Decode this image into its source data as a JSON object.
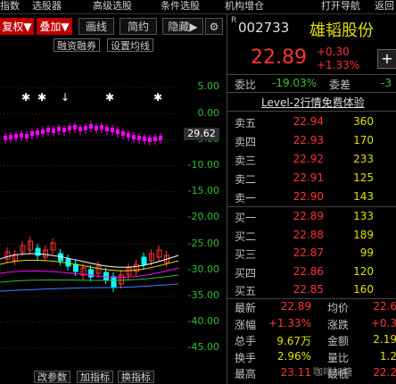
{
  "menu": {
    "items": [
      "指数",
      "选股器",
      "高级选股",
      "条件选股",
      "机构增仓",
      "打开导航",
      "返回"
    ]
  },
  "toolbar": {
    "fuquan": "复权▼",
    "diejia": "叠加▼",
    "huaxian": "画线",
    "jianyue": "简约",
    "yincang": "隐藏▶",
    "gear": "⚙"
  },
  "subbar": {
    "markers": [
      "✱",
      "✱",
      "↓",
      "✱",
      "✱"
    ],
    "rongzi": "融资融券",
    "junxian": "设置均线"
  },
  "chart": {
    "yaxis": [
      "5.00",
      "0.00",
      "-5.00",
      "-10.00",
      "-15.00",
      "-20.00",
      "-25.00",
      "-30.00",
      "-35.00",
      "-40.00",
      "-45.00"
    ],
    "last_label": "29.62",
    "line_color": "#ff00ff",
    "up_color": "#ff3333",
    "down_color": "#00ffff",
    "ma_colors": [
      "#ffffff",
      "#e0e000",
      "#ff00ff",
      "#30c030",
      "#4080ff"
    ]
  },
  "bottom_tabs": [
    "改参数",
    "加指标",
    "换指标"
  ],
  "quote": {
    "code_prefix": "R",
    "code": "002733",
    "name": "雄韬股份",
    "price": "22.89",
    "change": "+0.30",
    "change_pct": "+1.33%",
    "plus_button": "+",
    "weibi_label": "委比",
    "weibi": "-19.03%",
    "weicha_label": "委差",
    "weicha": "-3",
    "level2": "Level-2行情免费体验",
    "asks": [
      {
        "name": "卖五",
        "price": "22.94",
        "vol": "360"
      },
      {
        "name": "卖四",
        "price": "22.93",
        "vol": "170"
      },
      {
        "name": "卖三",
        "price": "22.92",
        "vol": "233"
      },
      {
        "name": "卖二",
        "price": "22.91",
        "vol": "125"
      },
      {
        "name": "卖一",
        "price": "22.90",
        "vol": "143"
      }
    ],
    "bids": [
      {
        "name": "买一",
        "price": "22.89",
        "vol": "133"
      },
      {
        "name": "买二",
        "price": "22.88",
        "vol": "189"
      },
      {
        "name": "买三",
        "price": "22.87",
        "vol": "99"
      },
      {
        "name": "买四",
        "price": "22.86",
        "vol": "120"
      },
      {
        "name": "买五",
        "price": "22.85",
        "vol": "160"
      }
    ],
    "stats": [
      {
        "l1": "最新",
        "v1": "22.89",
        "l2": "均价",
        "v2": "22.6"
      },
      {
        "l1": "涨幅",
        "v1": "+1.33%",
        "l2": "涨跌",
        "v2": "+0.3"
      },
      {
        "l1": "总手",
        "v1": "9.67万",
        "l2": "金额",
        "v2": "2.19"
      },
      {
        "l1": "换手",
        "v1": "2.96%",
        "l2": "量比",
        "v2": "1.2"
      },
      {
        "l1": "最高",
        "v1": "23.11",
        "l2": "最低",
        "v2": "22.2"
      }
    ],
    "watermark": "咖啡加糖"
  }
}
